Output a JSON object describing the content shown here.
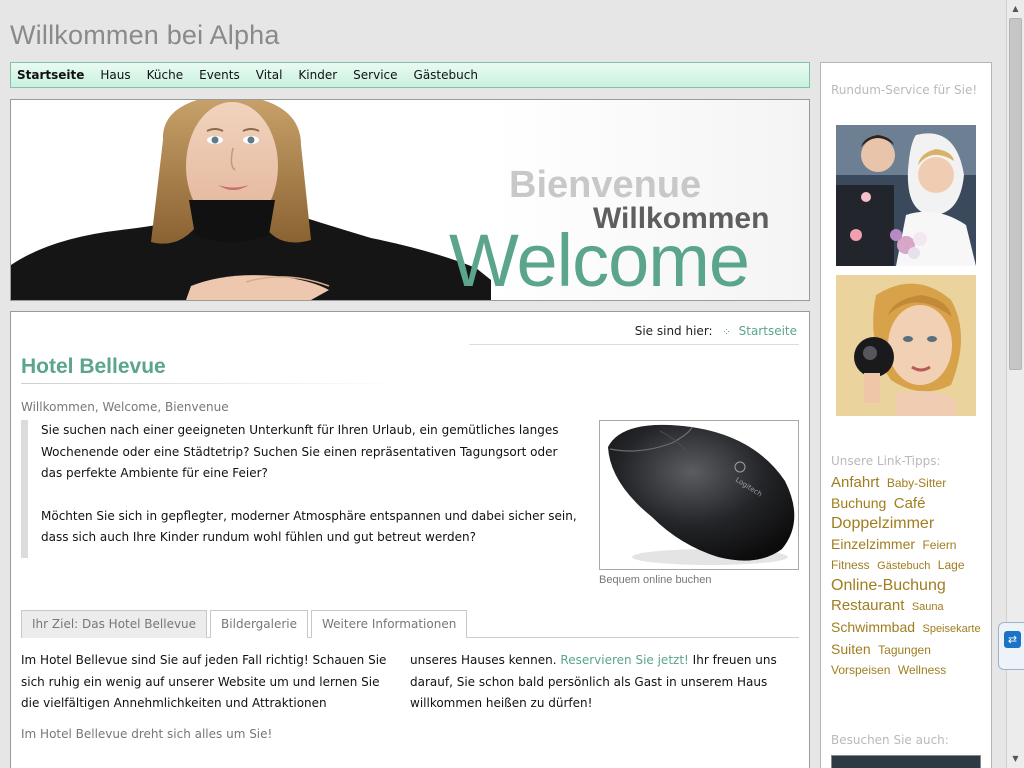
{
  "site": {
    "title": "Willkommen bei Alpha"
  },
  "nav": {
    "items": [
      "Startseite",
      "Haus",
      "Küche",
      "Events",
      "Vital",
      "Kinder",
      "Service",
      "Gästebuch"
    ]
  },
  "banner": {
    "word1": "Bienvenue",
    "word2": "Willkommen",
    "word3": "Welcome"
  },
  "breadcrumb": {
    "label": "Sie sind hier:",
    "current": "Startseite"
  },
  "main": {
    "title": "Hotel Bellevue",
    "subtitle": "Willkommen, Welcome, Bienvenue",
    "intro_p1": "Sie suchen nach einer geeigneten Unterkunft für Ihren Urlaub, ein gemütliches langes Wochenende oder eine Städtetrip? Suchen Sie einen repräsentativen Tagungsort oder das perfekte Ambiente für eine Feier?",
    "intro_p2": "Möchten Sie sich in gepflegter, moderner Atmosphäre entspannen und dabei sicher sein, dass sich auch Ihre Kinder rundum wohl fühlen und gut betreut werden?",
    "photo_caption": "Bequem online buchen",
    "mouse_brand": "Logitech",
    "tabs": [
      "Ihr Ziel: Das Hotel Bellevue",
      "Bildergalerie",
      "Weitere Informationen"
    ],
    "col1_text": "Im Hotel Bellevue sind Sie auf jeden Fall richtig! Schauen Sie sich ruhig ein wenig auf unserer Website um und lernen Sie die vielfältigen Annehmlichkeiten und Attraktionen",
    "col2_before": "unseres Hauses kennen.",
    "col2_link": "Reservieren Sie jetzt!",
    "col2_after": "Ihr freuen uns darauf, Sie schon bald persönlich als Gast in unserem Haus willkommen heißen zu dürfen!",
    "subheading2": "Im Hotel Bellevue dreht sich alles um Sie!"
  },
  "sidebar": {
    "heading1": "Rundum-Service für Sie!",
    "heading2": "Unsere Link-Tipps:",
    "heading3": "Besuchen Sie auch:",
    "tags": [
      {
        "label": "Anfahrt",
        "size": "s4"
      },
      {
        "label": "Baby-Sitter",
        "size": "s2"
      },
      {
        "label": "Buchung",
        "size": "s3"
      },
      {
        "label": "Café",
        "size": "s4"
      },
      {
        "label": "Doppelzimmer",
        "size": "s5"
      },
      {
        "label": "Einzelzimmer",
        "size": "s3"
      },
      {
        "label": "Feiern",
        "size": "s2"
      },
      {
        "label": "Fitness",
        "size": "s2"
      },
      {
        "label": "Gästebuch",
        "size": "s1"
      },
      {
        "label": "Lage",
        "size": "s2"
      },
      {
        "label": "Online-Buchung",
        "size": "s5"
      },
      {
        "label": "Restaurant",
        "size": "s4"
      },
      {
        "label": "Sauna",
        "size": "s1"
      },
      {
        "label": "Schwimmbad",
        "size": "s3"
      },
      {
        "label": "Speisekarte",
        "size": "s1"
      },
      {
        "label": "Suiten",
        "size": "s3"
      },
      {
        "label": "Tagungen",
        "size": "s2"
      },
      {
        "label": "Vorspeisen",
        "size": "s2"
      },
      {
        "label": "Wellness",
        "size": "s2"
      }
    ]
  },
  "colors": {
    "accent": "#5aa58b",
    "tag": "#a07d1e",
    "nav_bg": "#d2f4e4"
  }
}
